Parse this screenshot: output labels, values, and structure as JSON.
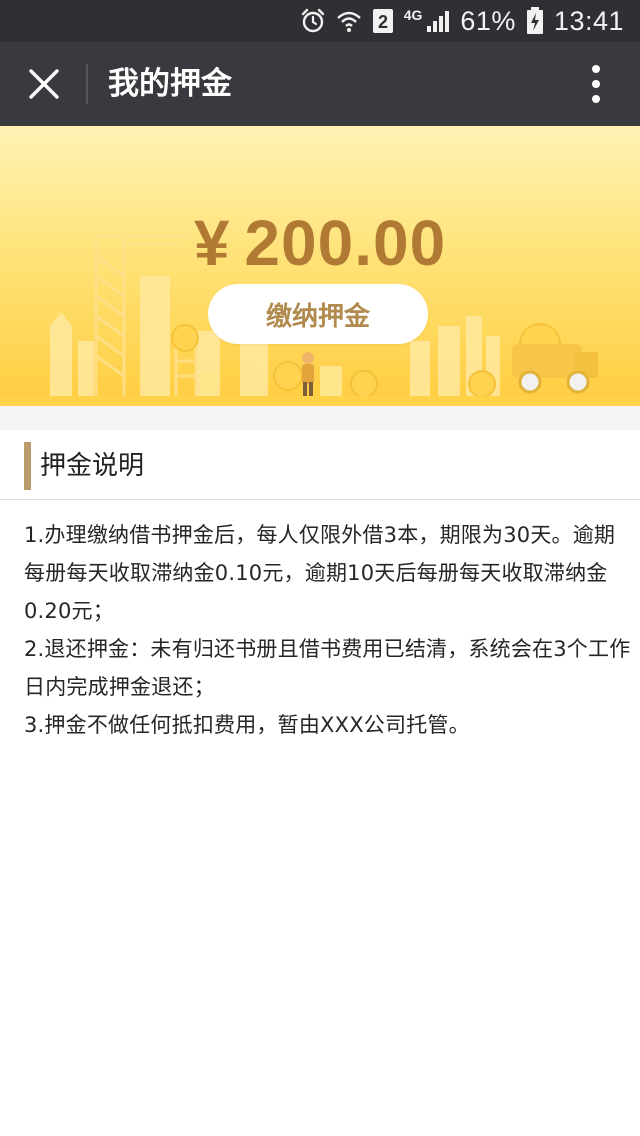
{
  "status_bar": {
    "sim_slot": "2",
    "network": "4G",
    "battery_percent": "61%",
    "time": "13:41",
    "icons": [
      "alarm-icon",
      "wifi-icon",
      "sim-icon",
      "signal-icon",
      "battery-charging-icon"
    ]
  },
  "nav": {
    "title": "我的押金",
    "close_icon": "close-icon",
    "more_icon": "more-vertical-icon"
  },
  "banner": {
    "currency": "¥",
    "amount": "200.00",
    "pay_button_label": "缴纳押金"
  },
  "section": {
    "title": "押金说明",
    "items": [
      "1.办理缴纳借书押金后，每人仅限外借3本，期限为30天。逾期每册每天收取滞纳金0.10元，逾期10天后每册每天收取滞纳金0.20元；",
      "2.退还押金：未有归还书册且借书费用已结清，系统会在3个工作日内完成押金退还；",
      "3.押金不做任何抵扣费用，暂由XXX公司托管。"
    ]
  },
  "colors": {
    "status_bar_bg": "#2e3033",
    "nav_bg": "#393a3f",
    "amount_color": "#b07a34",
    "button_text": "#b18a4e",
    "accent_bar": "#bb9b6b"
  }
}
